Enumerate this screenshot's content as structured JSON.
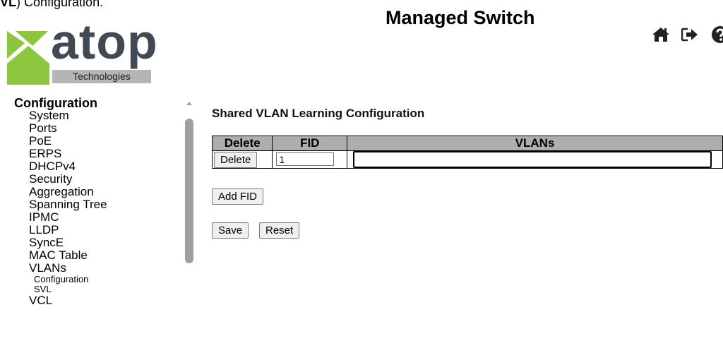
{
  "caption": {
    "bold": "VL",
    "rest": ") Configuration."
  },
  "header": {
    "title": "Managed Switch",
    "icons": [
      "home-icon",
      "logout-icon",
      "help-icon"
    ]
  },
  "logo": {
    "wordmark": "atop",
    "tagline": "Technologies"
  },
  "nav": {
    "heading": "Configuration",
    "items": [
      "System",
      "Ports",
      "PoE",
      "ERPS",
      "DHCPv4",
      "Security",
      "Aggregation",
      "Spanning Tree",
      "IPMC",
      "LLDP",
      "SyncE",
      "MAC Table",
      "VLANs"
    ],
    "vlan_subitems": [
      "Configuration",
      "SVL"
    ],
    "after": [
      "VCL"
    ]
  },
  "main": {
    "title": "Shared VLAN Learning Configuration",
    "table": {
      "headers": [
        "Delete",
        "FID",
        "VLANs"
      ],
      "rows": [
        {
          "delete_label": "Delete",
          "fid": "1",
          "vlans": ""
        }
      ]
    },
    "add_fid_label": "Add FID",
    "save_label": "Save",
    "reset_label": "Reset"
  },
  "colors": {
    "header_bg": "#aeaeae",
    "logo_green": "#8cc63f",
    "logo_text": "#404a55"
  }
}
